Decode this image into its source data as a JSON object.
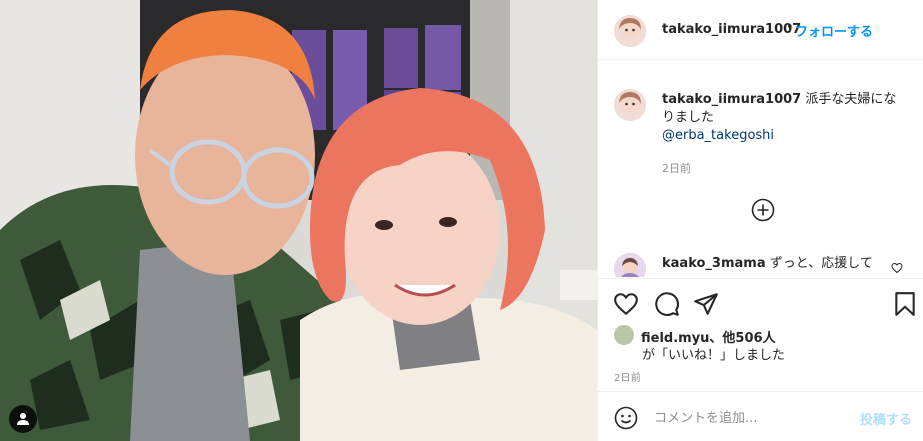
{
  "colors": {
    "accent": "#0095f6",
    "mention": "#00376b",
    "muted": "#8e8e8e",
    "post_disabled": "#b2dffc"
  },
  "photo": {
    "alt_icon": "person-icon"
  },
  "header": {
    "username": "takako_iimura1007",
    "separator": "•",
    "follow_label": "フォローする"
  },
  "caption": {
    "username": "takako_iimura1007",
    "text": "派手な夫婦になりました",
    "mention": "@erba_takegoshi",
    "time": "2日前"
  },
  "load_more_icon": "plus-circle-icon",
  "comment": {
    "username": "kaako_3mama",
    "text": "ずっと、応援して"
  },
  "actions": {
    "like_icon": "heart-icon",
    "comment_icon": "comment-icon",
    "share_icon": "paper-plane-icon",
    "save_icon": "bookmark-icon"
  },
  "likes": {
    "likers": "field.myu、他506人",
    "suffix": "が「いいね！」しました"
  },
  "post_time": "2日前",
  "add_comment": {
    "emoji_icon": "smiley-icon",
    "placeholder": "コメントを追加...",
    "post_label": "投稿する"
  }
}
